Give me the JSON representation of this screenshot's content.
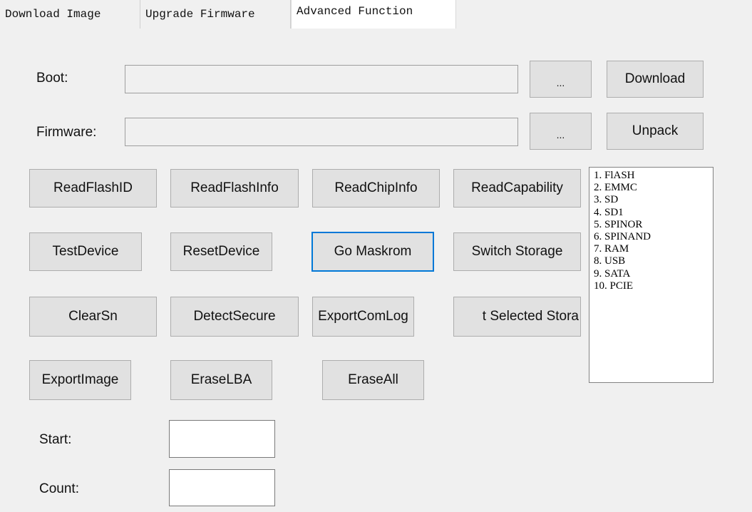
{
  "tabs": [
    {
      "label": "Download Image",
      "active": false
    },
    {
      "label": "Upgrade Firmware",
      "active": false
    },
    {
      "label": "Advanced Function",
      "active": true
    }
  ],
  "boot": {
    "label": "Boot:",
    "value": "",
    "browse_label": "...",
    "action_label": "Download"
  },
  "firmware": {
    "label": "Firmware:",
    "value": "",
    "browse_label": "...",
    "action_label": "Unpack"
  },
  "buttons": {
    "read_flash_id": "ReadFlashID",
    "read_flash_info": "ReadFlashInfo",
    "read_chip_info": "ReadChipInfo",
    "read_capability": "ReadCapability",
    "test_device": "TestDevice",
    "reset_device": "ResetDevice",
    "go_maskrom": "Go Maskrom",
    "switch_storage": "Switch Storage",
    "clear_sn": "ClearSn",
    "detect_secure": "DetectSecure",
    "export_com_log": "ExportComLog",
    "export_selected_storage": "t Selected Stora",
    "export_image": "ExportImage",
    "erase_lba": "EraseLBA",
    "erase_all": "EraseAll"
  },
  "storage_list": [
    "1. FlASH",
    "2. EMMC",
    "3. SD",
    "4. SD1",
    "5. SPINOR",
    "6. SPINAND",
    "7. RAM",
    "8. USB",
    "9. SATA",
    "10. PCIE"
  ],
  "start": {
    "label": "Start:",
    "value": ""
  },
  "count": {
    "label": "Count:",
    "value": ""
  },
  "colors": {
    "focus_border": "#0078d7",
    "button_bg": "#e1e1e1",
    "window_bg": "#f0f0f0"
  }
}
